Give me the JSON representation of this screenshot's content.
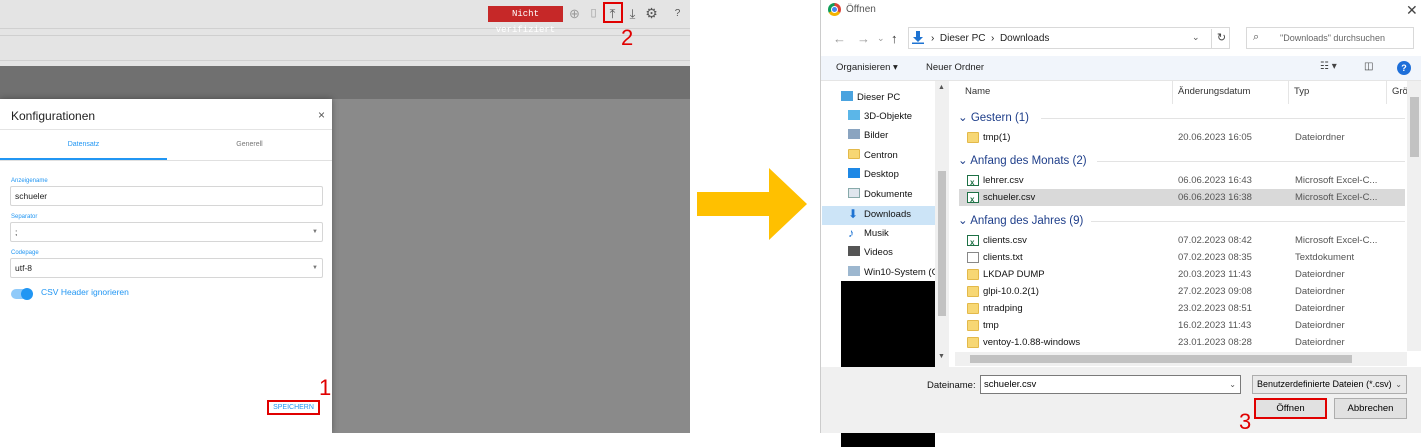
{
  "left": {
    "toolbar": {
      "badge": "Nicht verifiziert",
      "icons": [
        "plus-circle-icon",
        "trash-icon",
        "upload-icon",
        "download-icon",
        "gear-icon",
        "help-icon"
      ],
      "upload_symbol": "⤒",
      "download_symbol": "⤓",
      "gear_symbol": "⚙",
      "help_symbol": "?",
      "plus_symbol": "⊕",
      "trash_symbol": "🗑"
    },
    "step2": "2",
    "step1": "1",
    "dialog": {
      "title": "Konfigurationen",
      "close": "×",
      "tabs": [
        "Datensatz",
        "Generell"
      ],
      "fields": [
        {
          "label": "Anzeigename",
          "value": "schueler"
        },
        {
          "label": "Separator",
          "value": ";"
        },
        {
          "label": "Codepage",
          "value": "utf-8"
        }
      ],
      "toggle_label": "CSV Header ignorieren",
      "toggle_on": true,
      "save": "SPEICHERN"
    }
  },
  "arrow_color": "#ffc000",
  "explorer": {
    "title": "Öffnen",
    "close": "✕",
    "nav": {
      "back": "←",
      "forward": "→",
      "recent": "⌄",
      "up": "↑"
    },
    "path": [
      "Dieser PC",
      "Downloads"
    ],
    "path_sep": "›",
    "search_placeholder": "\"Downloads\" durchsuchen",
    "toolbar": {
      "organize": "Organisieren ▾",
      "new_folder": "Neuer Ordner"
    },
    "tree": [
      {
        "label": "Dieser PC",
        "icon": "pc-icon"
      },
      {
        "label": "3D-Objekte",
        "icon": "cube-icon"
      },
      {
        "label": "Bilder",
        "icon": "pictures-icon"
      },
      {
        "label": "Centron",
        "icon": "folder-icon"
      },
      {
        "label": "Desktop",
        "icon": "desktop-icon"
      },
      {
        "label": "Dokumente",
        "icon": "documents-icon"
      },
      {
        "label": "Downloads",
        "icon": "downloads-icon"
      },
      {
        "label": "Musik",
        "icon": "music-icon"
      },
      {
        "label": "Videos",
        "icon": "videos-icon"
      },
      {
        "label": "Win10-System (C",
        "icon": "drive-icon"
      }
    ],
    "columns": [
      "Name",
      "Änderungsdatum",
      "Typ",
      "Grö"
    ],
    "groups": [
      {
        "label": "Gestern (1)",
        "files": [
          {
            "name": "tmp(1)",
            "date": "20.06.2023 16:05",
            "type": "Dateiordner",
            "kind": "folder"
          }
        ]
      },
      {
        "label": "Anfang des Monats (2)",
        "files": [
          {
            "name": "lehrer.csv",
            "date": "06.06.2023 16:43",
            "type": "Microsoft Excel-C...",
            "kind": "xls"
          },
          {
            "name": "schueler.csv",
            "date": "06.06.2023 16:38",
            "type": "Microsoft Excel-C...",
            "kind": "xls",
            "selected": true
          }
        ]
      },
      {
        "label": "Anfang des Jahres (9)",
        "files": [
          {
            "name": "clients.csv",
            "date": "07.02.2023 08:42",
            "type": "Microsoft Excel-C...",
            "kind": "xls"
          },
          {
            "name": "clients.txt",
            "date": "07.02.2023 08:35",
            "type": "Textdokument",
            "kind": "txt"
          },
          {
            "name": "LKDAP DUMP",
            "date": "20.03.2023 11:43",
            "type": "Dateiordner",
            "kind": "folder"
          },
          {
            "name": "glpi-10.0.2(1)",
            "date": "27.02.2023 09:08",
            "type": "Dateiordner",
            "kind": "folder"
          },
          {
            "name": "ntradping",
            "date": "23.02.2023 08:51",
            "type": "Dateiordner",
            "kind": "folder"
          },
          {
            "name": "tmp",
            "date": "16.02.2023 11:43",
            "type": "Dateiordner",
            "kind": "folder"
          },
          {
            "name": "ventoy-1.0.88-windows",
            "date": "23.01.2023 08:28",
            "type": "Dateiordner",
            "kind": "folder"
          }
        ]
      }
    ],
    "filename_label": "Dateiname:",
    "filename_value": "schueler.csv",
    "filetype": "Benutzerdefinierte Dateien (*.csv)",
    "open_button": "Öffnen",
    "cancel_button": "Abbrechen",
    "step3": "3"
  }
}
